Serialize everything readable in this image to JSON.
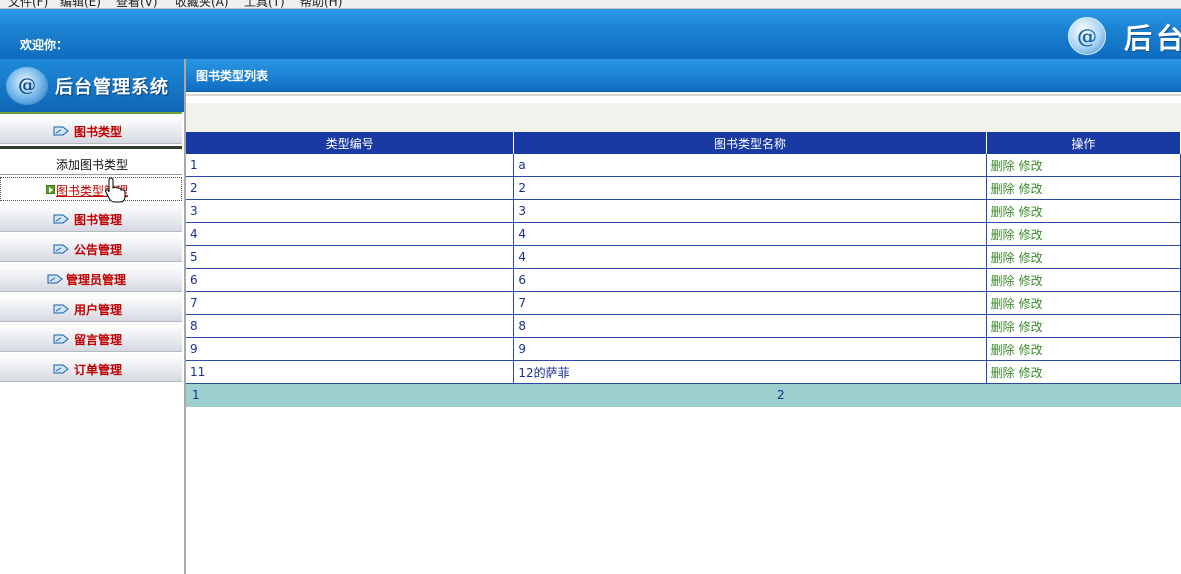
{
  "menubar": {
    "items": [
      "文件(F)",
      "编辑(E)",
      "查看(V)",
      "收藏夹(A)",
      "工具(T)",
      "帮助(H)"
    ]
  },
  "header": {
    "welcome": "欢迎你：",
    "logo_text": "后台",
    "logo_glyph": "@"
  },
  "sidebar": {
    "logo_title": "后台管理系统",
    "logo_glyph": "@",
    "groups": [
      {
        "label": "图书类型"
      },
      {
        "label": "图书管理"
      },
      {
        "label": "公告管理"
      },
      {
        "label": "管理员管理"
      },
      {
        "label": "用户管理"
      },
      {
        "label": "留言管理"
      },
      {
        "label": "订单管理"
      }
    ],
    "sub_items": [
      {
        "label": "添加图书类型"
      },
      {
        "label": "图书类型管理"
      }
    ]
  },
  "main": {
    "title": "图书类型列表",
    "columns": [
      "类型编号",
      "图书类型名称",
      "操作"
    ],
    "rows": [
      {
        "id": "1",
        "name": "a"
      },
      {
        "id": "2",
        "name": "2"
      },
      {
        "id": "3",
        "name": "3"
      },
      {
        "id": "4",
        "name": "4"
      },
      {
        "id": "5",
        "name": "4"
      },
      {
        "id": "6",
        "name": "6"
      },
      {
        "id": "7",
        "name": "7"
      },
      {
        "id": "8",
        "name": "8"
      },
      {
        "id": "9",
        "name": "9"
      },
      {
        "id": "11",
        "name": "12的萨菲"
      }
    ],
    "actions": {
      "delete": "删除",
      "edit": "修改"
    },
    "pager": {
      "left": "1",
      "center": "2"
    }
  },
  "colors": {
    "header_blue": "#1a7fcf",
    "table_header": "#1a3aa3",
    "nav_label_red": "#c00000",
    "action_green": "#3a8a2a",
    "pager_bg": "#9ecfcf"
  }
}
